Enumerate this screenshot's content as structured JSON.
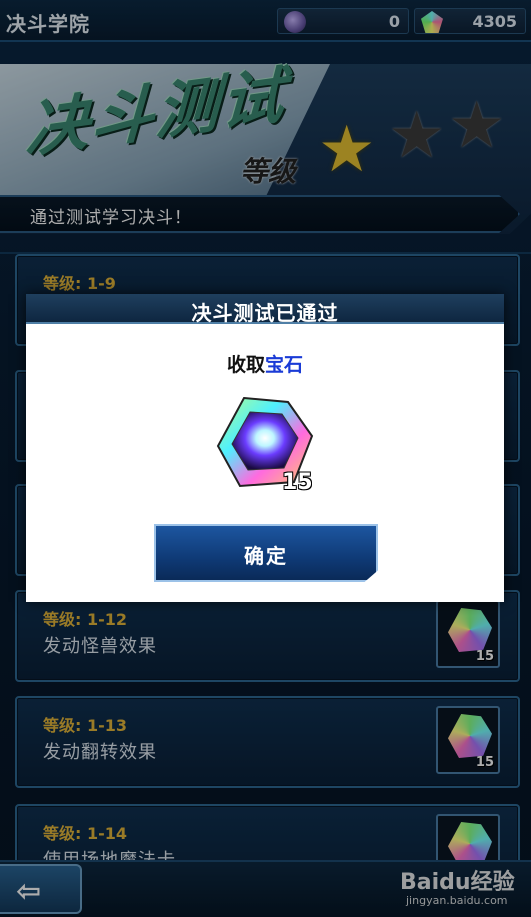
{
  "app": {
    "title": "决斗学院"
  },
  "currencies": [
    {
      "name": "medal",
      "icon": "medal-icon",
      "value": "0"
    },
    {
      "name": "gems",
      "icon": "gem-icon",
      "value": "4305"
    }
  ],
  "banner": {
    "title": "决斗测试",
    "level_label": "等级",
    "stars_filled": 1,
    "stars_total": 3,
    "subtitle": "通过测试学习决斗！"
  },
  "cards": [
    {
      "level": "等级: 1-9",
      "name": ""
    },
    {
      "level": "",
      "name": ""
    },
    {
      "level": "",
      "name": ""
    },
    {
      "level": "等级: 1-12",
      "name": "发动怪兽效果",
      "reward_count": "15"
    },
    {
      "level": "等级: 1-13",
      "name": "发动翻转效果",
      "reward_count": "15"
    },
    {
      "level": "等级: 1-14",
      "name": "使用场地魔法卡"
    }
  ],
  "modal": {
    "title": "决斗测试已通过",
    "receive_prefix": "收取",
    "receive_item": "宝石",
    "reward_count": "15",
    "confirm_label": "确定"
  },
  "watermark": {
    "main": "Baidu经验",
    "sub": "jingyan.baidu.com"
  },
  "colors": {
    "accent": "#1a3bd6",
    "level_gold": "#e3b53a",
    "star_gold": "#e6c233"
  }
}
